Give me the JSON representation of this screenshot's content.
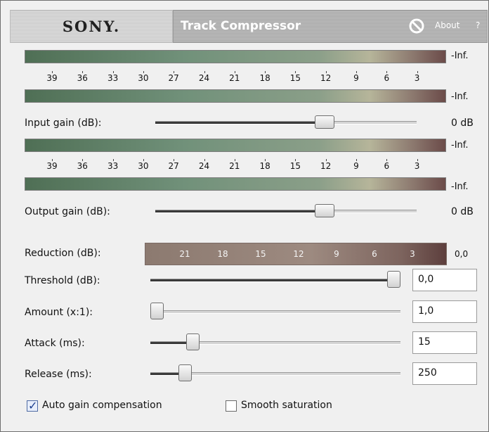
{
  "header": {
    "brand": "SONY.",
    "title": "Track Compressor",
    "about_label": "About",
    "help_label": "?"
  },
  "input_meter": {
    "scale": [
      "39",
      "36",
      "33",
      "30",
      "27",
      "24",
      "21",
      "18",
      "15",
      "12",
      "9",
      "6",
      "3"
    ],
    "left_peak": "-Inf.",
    "right_peak": "-Inf."
  },
  "output_meter": {
    "scale": [
      "39",
      "36",
      "33",
      "30",
      "27",
      "24",
      "21",
      "18",
      "15",
      "12",
      "9",
      "6",
      "3"
    ],
    "left_peak": "-Inf.",
    "right_peak": "-Inf."
  },
  "input_gain": {
    "label": "Input gain (dB):",
    "value": "0 dB",
    "level": 0.66
  },
  "output_gain": {
    "label": "Output gain (dB):",
    "value": "0 dB",
    "level": 0.66
  },
  "reduction": {
    "label": "Reduction (dB):",
    "scale": [
      "21",
      "18",
      "15",
      "12",
      "9",
      "6",
      "3"
    ],
    "value": "0,0"
  },
  "threshold": {
    "label": "Threshold (dB):",
    "value": "0,0",
    "level": 1.0
  },
  "amount": {
    "label": "Amount (x:1):",
    "value": "1,0",
    "level": 0.0
  },
  "attack": {
    "label": "Attack (ms):",
    "value": "15",
    "level": 0.15
  },
  "release": {
    "label": "Release (ms):",
    "value": "250",
    "level": 0.12
  },
  "options": {
    "auto_gain": {
      "label": "Auto gain compensation",
      "checked": true
    },
    "smooth_saturation": {
      "label": "Smooth saturation",
      "checked": false
    }
  },
  "colors": {
    "meter_green": "#71917a",
    "meter_red": "#6b4b49",
    "header_gray": "#bdbdbd"
  }
}
